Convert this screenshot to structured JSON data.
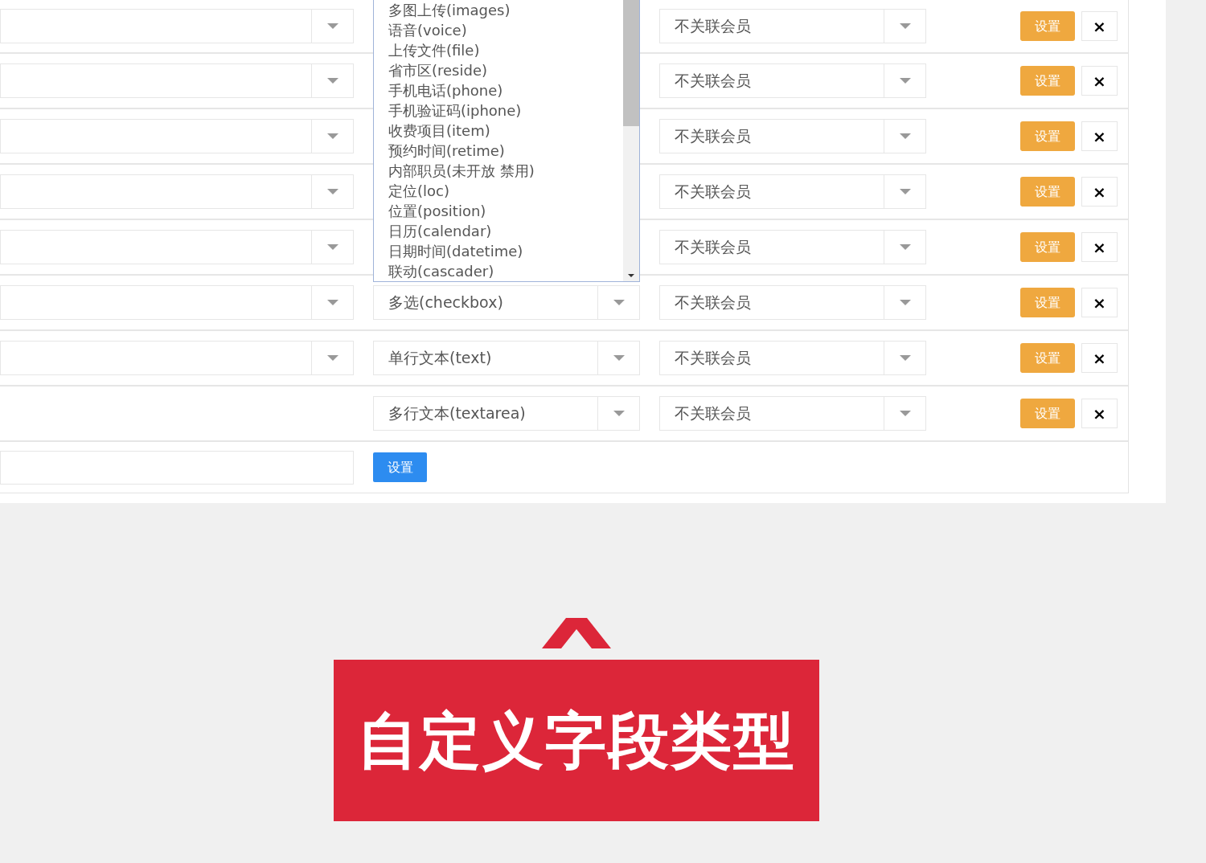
{
  "rows": [
    {
      "name_select": true,
      "type": null,
      "member": "不关联会员",
      "set_button": "设置",
      "delete_button": "×"
    },
    {
      "name_select": true,
      "type": null,
      "member": "不关联会员",
      "set_button": "设置",
      "delete_button": "×"
    },
    {
      "name_select": true,
      "type": null,
      "member": "不关联会员",
      "set_button": "设置",
      "delete_button": "×"
    },
    {
      "name_select": true,
      "type": null,
      "member": "不关联会员",
      "set_button": "设置",
      "delete_button": "×"
    },
    {
      "name_select": true,
      "type": null,
      "member": "不关联会员",
      "set_button": "设置",
      "delete_button": "×"
    },
    {
      "name_select": true,
      "type": "多选(checkbox)",
      "member": "不关联会员",
      "set_button": "设置",
      "delete_button": "×"
    },
    {
      "name_select": true,
      "type": "单行文本(text)",
      "member": "不关联会员",
      "set_button": "设置",
      "delete_button": "×"
    },
    {
      "name_select": false,
      "type": "多行文本(textarea)",
      "member": "不关联会员",
      "set_button": "设置",
      "delete_button": "×"
    }
  ],
  "type_dropdown": {
    "options": [
      "多图上传(images)",
      "语音(voice)",
      "上传文件(file)",
      "省市区(reside)",
      "手机电话(phone)",
      "手机验证码(iphone)",
      "收费项目(item)",
      "预约时间(retime)",
      "内部职员(未开放 禁用)",
      "定位(loc)",
      "位置(position)",
      "日历(calendar)",
      "日期时间(datetime)",
      "联动(cascader)"
    ]
  },
  "footer": {
    "button": "设置"
  },
  "banner": {
    "title": "自定义字段类型"
  }
}
